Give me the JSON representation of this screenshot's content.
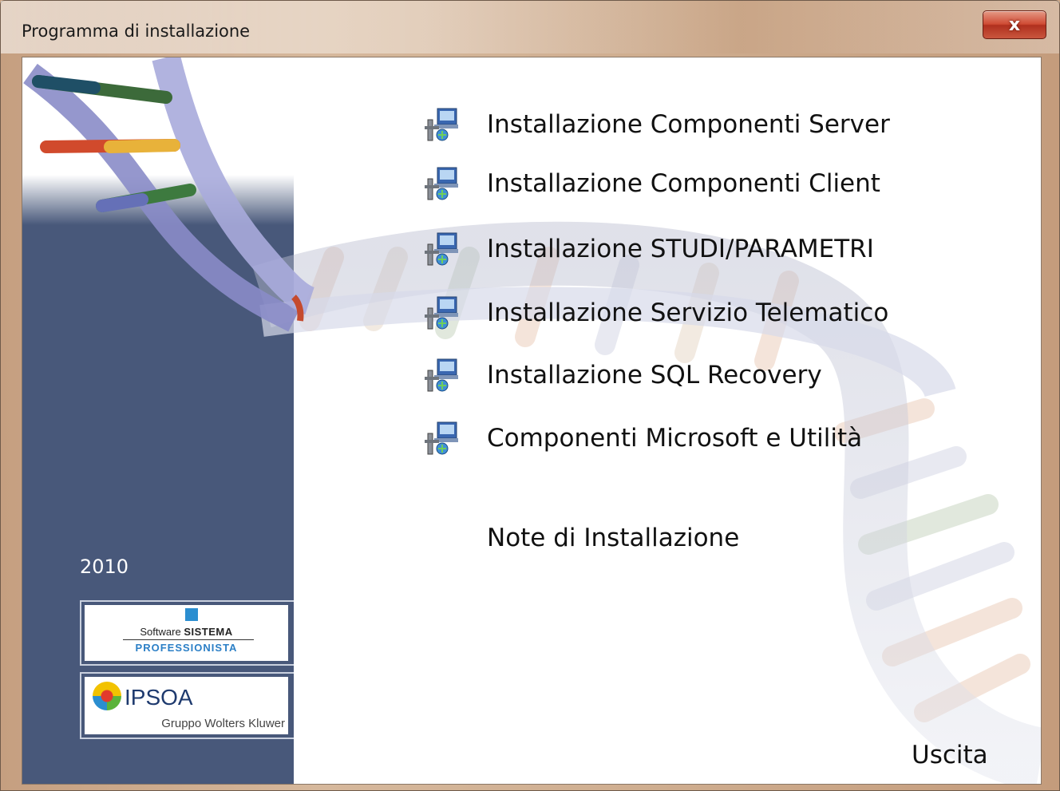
{
  "window": {
    "title": "Programma di installazione",
    "close_label": "x"
  },
  "sidebar": {
    "year": "2010",
    "logos": [
      {
        "name": "Software SISTEMA PROFESSIONISTA",
        "line1_prefix": "Software",
        "line1_bold": "SISTEMA",
        "line2": "PROFESSIONISTA"
      },
      {
        "name": "IPSOA Gruppo Wolters Kluwer",
        "brand": "IPSOA",
        "sub": "Gruppo Wolters Kluwer"
      }
    ]
  },
  "menu": {
    "items": [
      {
        "label": "Installazione Componenti Server",
        "icon": "installer-icon"
      },
      {
        "label": "Installazione Componenti Client",
        "icon": "installer-icon"
      },
      {
        "label": "Installazione STUDI/PARAMETRI",
        "icon": "installer-icon"
      },
      {
        "label": "Installazione Servizio Telematico",
        "icon": "installer-icon"
      },
      {
        "label": "Installazione SQL Recovery",
        "icon": "installer-icon"
      },
      {
        "label": "Componenti Microsoft e Utilità",
        "icon": "installer-icon"
      }
    ],
    "notes_label": "Note di Installazione",
    "exit_label": "Uscita"
  },
  "colors": {
    "sidebar_bg": "#48587a",
    "close_button": "#c9442f"
  }
}
